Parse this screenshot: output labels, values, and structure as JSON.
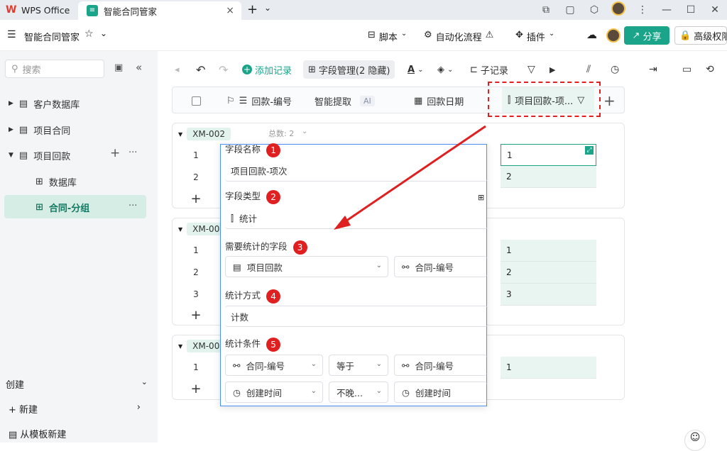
{
  "titlebar": {
    "wps_label": "WPS Office",
    "active_tab": "智能合同管家",
    "close": "×",
    "new_tab": "+",
    "tab_menu": "⌄",
    "minimize": "—",
    "maximize": "☐",
    "close_window": "✕"
  },
  "app": {
    "menu_icon": "☰",
    "title": "智能合同管家",
    "star": "☆",
    "chevron": "⌄",
    "script": "脚本",
    "automation": "自动化流程",
    "plugin": "插件",
    "share": "分享",
    "permission": "高级权限"
  },
  "sidebar": {
    "search_placeholder": "搜索",
    "items": [
      {
        "label": "客户数据库"
      },
      {
        "label": "项目合同"
      },
      {
        "label": "项目回款"
      },
      {
        "label": "数据库"
      },
      {
        "label": "合同-分组"
      }
    ],
    "create": "创建",
    "new": "新建",
    "from_template": "从模板新建",
    "more": "···",
    "add": "+"
  },
  "toolbar": {
    "add_record": "添加记录",
    "field_manage": "字段管理(2 隐藏)",
    "sub_record": "子记录"
  },
  "columns": {
    "col1": "回款-编号",
    "col2": "智能提取",
    "ai": "AI",
    "col3": "回款日期",
    "col4": "项目回款-项..."
  },
  "groups": [
    {
      "tag": "XM-002",
      "count_label": "总数: 2",
      "rows": [
        "1",
        "2"
      ],
      "values": [
        "1",
        "2"
      ]
    },
    {
      "tag": "XM-00",
      "rows": [
        "1",
        "2",
        "3"
      ],
      "values": [
        "1",
        "2",
        "3"
      ]
    },
    {
      "tag": "XM-00",
      "rows": [
        "1"
      ],
      "values": [
        "1"
      ]
    }
  ],
  "popup": {
    "field_name_label": "字段名称",
    "field_name_value": "项目回款-项次",
    "field_type_label": "字段类型",
    "field_type_value": "统计",
    "stat_field_label": "需要统计的字段",
    "stat_field_value": "项目回款",
    "stat_field_link": "合同-编号",
    "stat_method_label": "统计方式",
    "stat_method_value": "计数",
    "condition_label": "统计条件",
    "cond1_field": "合同-编号",
    "cond1_op": "等于",
    "cond1_value": "合同-编号",
    "cond2_field": "创建时间",
    "cond2_op": "不晚...",
    "cond2_value": "创建时间",
    "badges": [
      "1",
      "2",
      "3",
      "4",
      "5"
    ]
  },
  "colors": {
    "accent": "#1aa58b",
    "annotation": "#e02020",
    "selected": "#d6ede6"
  }
}
